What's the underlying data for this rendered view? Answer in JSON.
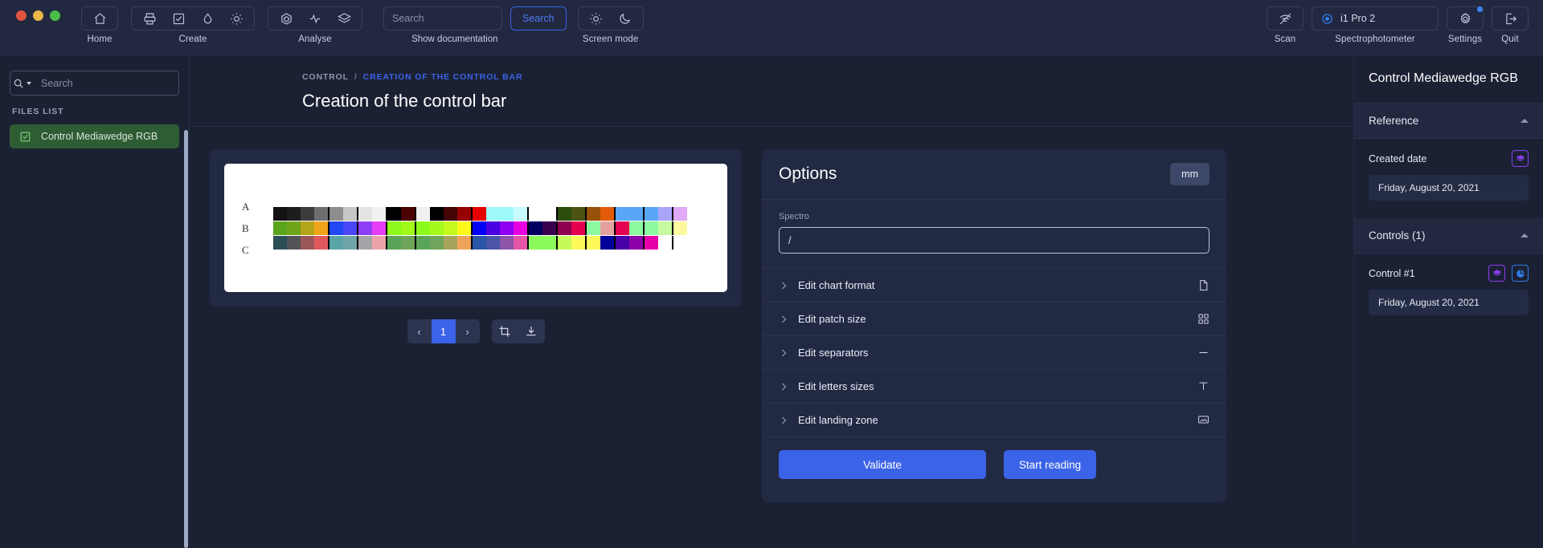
{
  "window": {
    "traffic_lights": [
      "close",
      "minimize",
      "maximize"
    ]
  },
  "toolbar": {
    "groups": [
      {
        "label": "Home",
        "icons": [
          "home-icon"
        ]
      },
      {
        "label": "Create",
        "icons": [
          "printer-icon",
          "check-square-icon",
          "droplet-icon",
          "sun-icon"
        ]
      },
      {
        "label": "Analyse",
        "icons": [
          "cube-icon",
          "pulse-icon",
          "layers-icon"
        ]
      }
    ],
    "documentation": {
      "label": "Show documentation",
      "search_placeholder": "Search",
      "search_value": "",
      "button_label": "Search"
    },
    "screen_mode": {
      "label": "Screen mode",
      "icons": [
        "sun-icon",
        "moon-icon"
      ]
    },
    "scan": {
      "label": "Scan",
      "icon": "scan-off-icon"
    },
    "spectrophotometer": {
      "label": "Spectrophotometer",
      "device": "i1 Pro 2",
      "icon": "target-icon"
    },
    "settings": {
      "label": "Settings",
      "icon": "gear-icon",
      "badge": true
    },
    "quit": {
      "label": "Quit",
      "icon": "logout-icon"
    }
  },
  "sidebar": {
    "search_placeholder": "Search",
    "search_value": "",
    "search_icon": "search-icon",
    "files_list_title": "FILES LIST",
    "files": [
      {
        "label": "Control Mediawedge RGB",
        "icon": "check-square-icon",
        "selected": true
      }
    ]
  },
  "main": {
    "breadcrumb": {
      "parent": "CONTROL",
      "separator": "/",
      "current": "CREATION OF THE CONTROL BAR"
    },
    "title": "Creation of the control bar",
    "pagination": {
      "prev": "‹",
      "pages": [
        "1"
      ],
      "current": "1",
      "next": "›"
    },
    "chart_tools": [
      "crop-icon",
      "download-icon"
    ]
  },
  "chart_data": {
    "type": "heatmap",
    "title": "Control bar patch chart",
    "row_labels": [
      "A",
      "B",
      "C"
    ],
    "columns": 29,
    "grid": false,
    "rows": [
      [
        "#121212",
        "#1d1d1d",
        "#3c3c3c",
        "#6e6e6e",
        "#8d8d8d",
        "#c6c6c6",
        "#e3e3e3",
        "#f1f1f1",
        "#000000",
        "#4a0200",
        "#f0f0f0",
        "#000000",
        "#430404",
        "#970000",
        "#e50000",
        "#9ef9fb",
        "#9ef9fb",
        "#c8fbfd",
        "#ffffff",
        "#ffffff",
        "#2c4e0d",
        "#4c5312",
        "#985109",
        "#e25b0a",
        "#5aa6f6",
        "#5aa6f6",
        "#5aa6f6",
        "#a9a6f9",
        "#e2a9f9"
      ],
      [
        "#5aa41b",
        "#6fa41b",
        "#b3a41b",
        "#efa41b",
        "#2348f6",
        "#4a48f6",
        "#8e3ef6",
        "#e53ef6",
        "#8cf91b",
        "#a0f91b",
        "#8cf91b",
        "#a5f91b",
        "#c6f91b",
        "#fdf91b",
        "#0000f6",
        "#4a00e0",
        "#8e00f0",
        "#e500e0",
        "#000060",
        "#3a0050",
        "#8e0050",
        "#e50050",
        "#8cf9a0",
        "#e5a0a0",
        "#e50050",
        "#8cf9a0",
        "#8cf9a0",
        "#c6f9a0",
        "#fdf9a0"
      ],
      [
        "#2c4f56",
        "#545458",
        "#9a5758",
        "#e1585c",
        "#5aa4a8",
        "#6fa4a8",
        "#a5a4a8",
        "#eda4a8",
        "#5aa45a",
        "#6fa45a",
        "#5aa45a",
        "#6fa45a",
        "#a5a45a",
        "#eda45a",
        "#2a55a8",
        "#4a55a8",
        "#8e55a8",
        "#e555a8",
        "#8cf95a",
        "#8cf95a",
        "#c6f95a",
        "#fdf95a",
        "#fdf95a",
        "#00009a",
        "#4a00a8",
        "#8e00a8",
        "#e500a8",
        "#ffffff",
        "#ffffff"
      ]
    ]
  },
  "options": {
    "title": "Options",
    "unit": "mm",
    "spectro": {
      "label": "Spectro",
      "value": "/",
      "placeholder": ""
    },
    "accordions": [
      {
        "label": "Edit chart format",
        "icon": "file-icon"
      },
      {
        "label": "Edit patch size",
        "icon": "grid-icon"
      },
      {
        "label": "Edit separators",
        "icon": "minus-icon"
      },
      {
        "label": "Edit letters sizes",
        "icon": "text-icon"
      },
      {
        "label": "Edit landing zone",
        "icon": "monitor-icon"
      }
    ],
    "validate_label": "Validate",
    "start_reading_label": "Start reading"
  },
  "right_panel": {
    "title": "Control Mediawedge RGB",
    "sections": [
      {
        "label": "Reference",
        "items": [
          {
            "label": "Created date",
            "value": "Friday, August 20, 2021",
            "icons": [
              "layers-icon"
            ]
          }
        ]
      },
      {
        "label": "Controls (1)",
        "items": [
          {
            "label": "Control #1",
            "value": "Friday, August 20, 2021",
            "icons": [
              "layers-icon",
              "pie-chart-icon"
            ]
          }
        ]
      }
    ]
  },
  "colors": {
    "accent": "#3b63e8",
    "background": "#1b2133",
    "panel": "#222942",
    "topbar": "#212840",
    "selected_file": "#2e5c33",
    "purple_icon": "#8b3ef0",
    "blue_icon": "#2f7dea"
  }
}
